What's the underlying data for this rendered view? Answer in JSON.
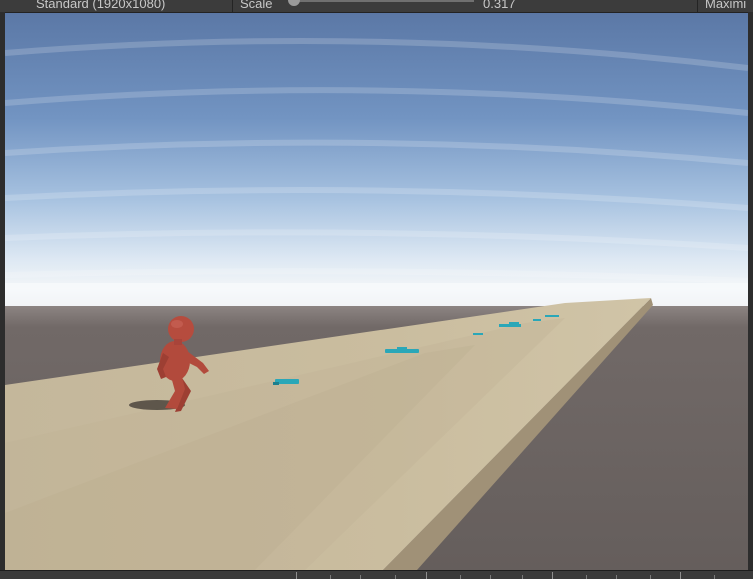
{
  "toolbar": {
    "resolution_label": "Standard (1920x1080)",
    "scale_label": "Scale",
    "scale_value": "0.317",
    "scale_slider_level": 0.0,
    "maximize_label": "Maximi"
  },
  "game_view": {
    "sky_color_top": "#5d7ba9",
    "sky_color_horizon": "#eef3f8",
    "ground_color": "#6d6563",
    "track_color": "#c5b89c",
    "track_side_color": "#9d8f76",
    "character_color": "#b44a3c",
    "pickup_color": "#2aa7b8",
    "pickup_count": 7
  }
}
